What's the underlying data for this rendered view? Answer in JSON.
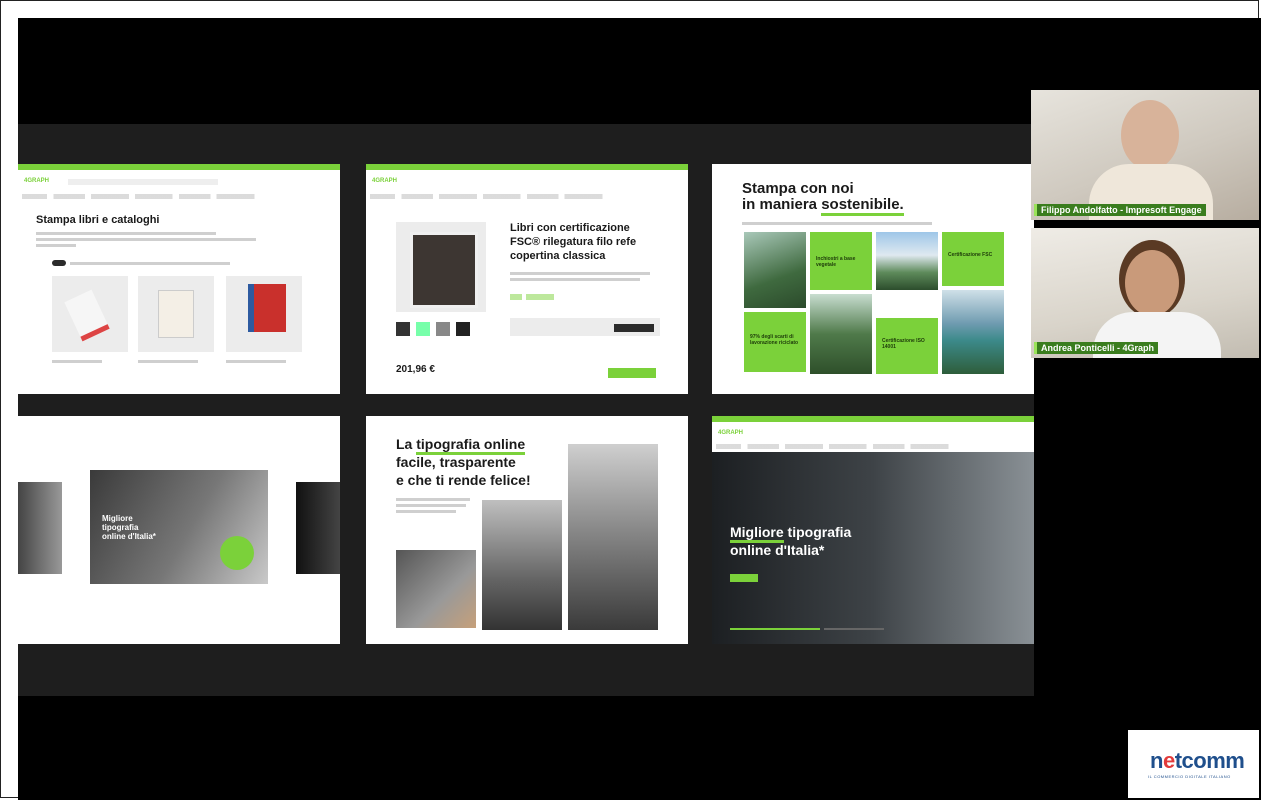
{
  "slides": {
    "s1": {
      "logo": "4GRAPH",
      "title": "Stampa libri e cataloghi"
    },
    "s2": {
      "logo": "4GRAPH",
      "title_lines": [
        "Libri con certificazione",
        "FSC® rilegatura filo refe",
        "copertina classica"
      ],
      "price": "201,96 €"
    },
    "s3": {
      "title_line1": "Stampa con noi",
      "title_line2_pre": "in maniera ",
      "title_line2_em": "sostenibile.",
      "tiles": [
        "Inchiostri a base vegetale",
        "Certificazione FSC",
        "97% degli scarti di lavorazione riciclato",
        "Certificazione ISO 14001"
      ]
    },
    "s4": {
      "headline": "Migliore tipografia online d'Italia*"
    },
    "s5": {
      "l1_pre": "La ",
      "l1_em": "tipografia online",
      "l2": "facile, trasparente",
      "l3": "e che ti rende felice!"
    },
    "s6": {
      "logo": "4GRAPH",
      "h_em": "Migliore",
      "h1_rest": " tipografia",
      "h2": "online d'Italia*"
    }
  },
  "participants": [
    {
      "name": "Filippo Andolfatto - Impresoft Engage"
    },
    {
      "name": "Andrea Ponticelli - 4Graph"
    }
  ],
  "brand": {
    "logo_pre": "n",
    "logo_e": "e",
    "logo_post": "tcomm",
    "tagline": "IL COMMERCIO DIGITALE ITALIANO"
  },
  "colors": {
    "accent": "#7bd13a",
    "stage": "#000000",
    "deck": "#1e1e1e",
    "netcomm_blue": "#1f4f8c"
  }
}
